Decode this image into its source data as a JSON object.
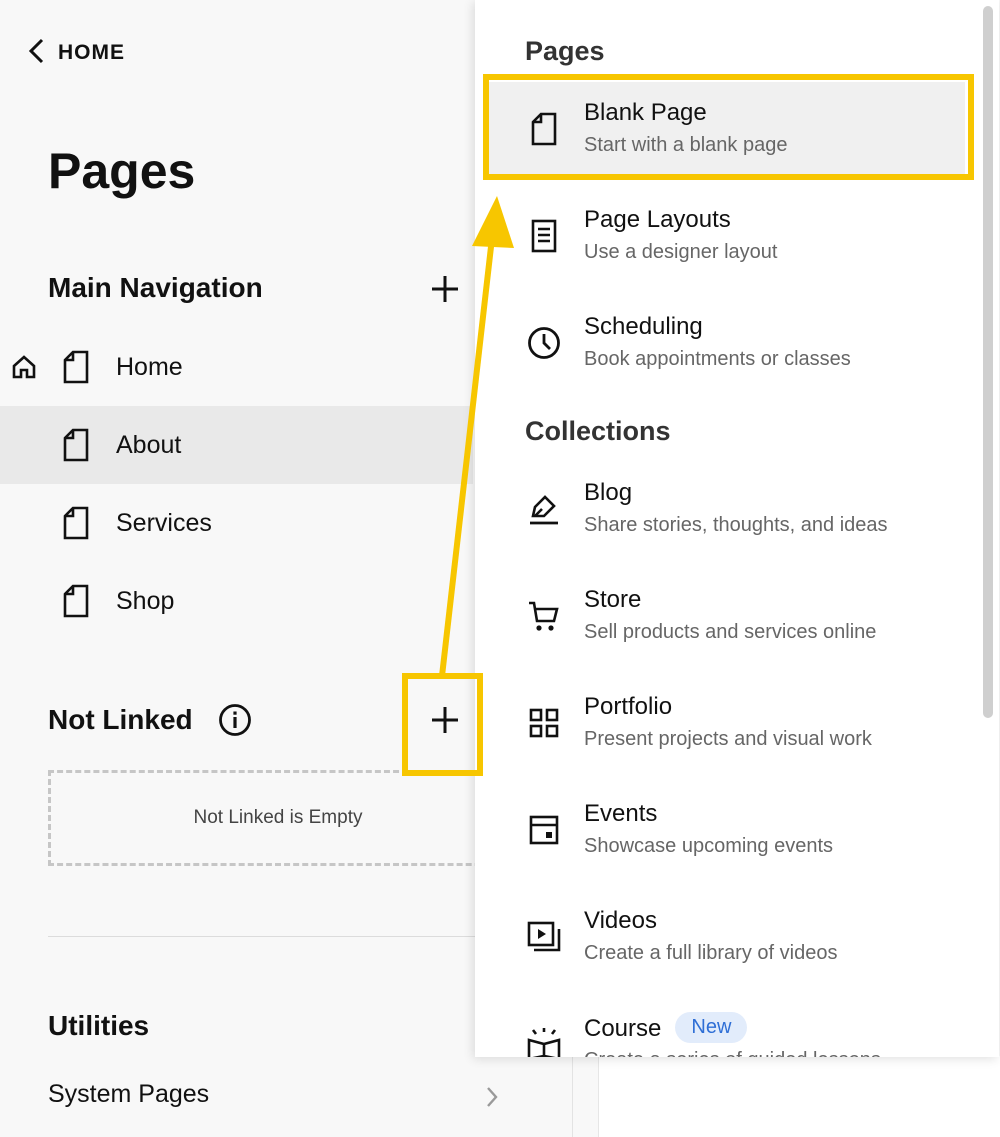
{
  "left": {
    "back_label": "HOME",
    "title": "Pages",
    "main_nav": {
      "title": "Main Navigation",
      "items": [
        {
          "label": "Home",
          "is_homepage": true
        },
        {
          "label": "About",
          "active": true
        },
        {
          "label": "Services"
        },
        {
          "label": "Shop"
        }
      ]
    },
    "not_linked": {
      "title": "Not Linked",
      "empty_text": "Not Linked is Empty"
    },
    "utilities": {
      "title": "Utilities",
      "system_pages": "System Pages"
    }
  },
  "menu": {
    "pages_heading": "Pages",
    "pages": [
      {
        "name": "Blank Page",
        "desc": "Start with a blank page",
        "icon": "blank-page-icon"
      },
      {
        "name": "Page Layouts",
        "desc": "Use a designer layout",
        "icon": "layout-icon"
      },
      {
        "name": "Scheduling",
        "desc": "Book appointments or classes",
        "icon": "clock-icon"
      }
    ],
    "collections_heading": "Collections",
    "collections": [
      {
        "name": "Blog",
        "desc": "Share stories, thoughts, and ideas",
        "icon": "pen-icon"
      },
      {
        "name": "Store",
        "desc": "Sell products and services online",
        "icon": "cart-icon"
      },
      {
        "name": "Portfolio",
        "desc": "Present projects and visual work",
        "icon": "grid-icon"
      },
      {
        "name": "Events",
        "desc": "Showcase upcoming events",
        "icon": "calendar-icon"
      },
      {
        "name": "Videos",
        "desc": "Create a full library of videos",
        "icon": "video-icon"
      },
      {
        "name": "Course",
        "desc": "Create a series of guided lessons",
        "icon": "book-icon",
        "badge": "New"
      }
    ]
  },
  "colors": {
    "highlight": "#f7c600",
    "badge_bg": "#e2ecfb",
    "badge_text": "#2f6fd6"
  }
}
